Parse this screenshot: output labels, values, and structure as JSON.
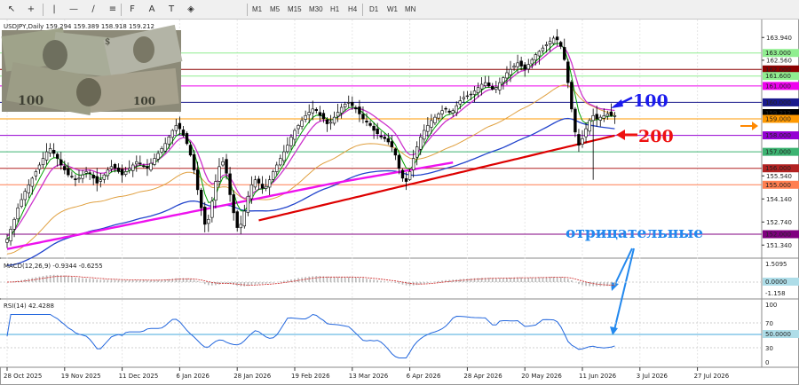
{
  "toolbar": {
    "tools": [
      {
        "name": "cursor-icon",
        "glyph": "↖"
      },
      {
        "name": "crosshair-icon",
        "glyph": "+"
      },
      {
        "name": "vertical-line-icon",
        "glyph": "|"
      },
      {
        "name": "horizontal-line-icon",
        "glyph": "—"
      },
      {
        "name": "trendline-icon",
        "glyph": "∕"
      },
      {
        "name": "channel-icon",
        "glyph": "≡"
      },
      {
        "name": "fibonacci-icon",
        "glyph": "F"
      },
      {
        "name": "text-icon",
        "glyph": "A"
      },
      {
        "name": "label-icon",
        "glyph": "T"
      },
      {
        "name": "shapes-icon",
        "glyph": "◈"
      }
    ],
    "timeframes": [
      "M1",
      "M5",
      "M15",
      "M30",
      "H1",
      "H4",
      "D1",
      "W1",
      "MN"
    ]
  },
  "chart": {
    "header": "USDJPY,Daily 159.294 159.389 158.918 159.212",
    "price_scale": {
      "labels": [
        {
          "text": "163.940",
          "v": 163.94
        },
        {
          "text": "162.560",
          "v": 162.56
        },
        {
          "text": "155.540",
          "v": 155.54
        },
        {
          "text": "154.140",
          "v": 154.14
        },
        {
          "text": "152.740",
          "v": 152.74
        },
        {
          "text": "151.340",
          "v": 151.34
        }
      ],
      "level_labels": [
        {
          "text": "163.000",
          "v": 163.0,
          "bg": "#90ee90",
          "fg": "#ffffff"
        },
        {
          "text": "162.000",
          "v": 162.0,
          "bg": "#8b0000",
          "fg": "#ffffff"
        },
        {
          "text": "161.600",
          "v": 161.6,
          "bg": "#90ee90",
          "fg": "#ffffff"
        },
        {
          "text": "161.000",
          "v": 161.0,
          "bg": "#ee00ee",
          "fg": "#ffffff"
        },
        {
          "text": "160.000",
          "v": 160.0,
          "bg": "#1a1a8c",
          "fg": "#ffffff"
        },
        {
          "text": "159.212",
          "v": 159.35,
          "bg": "#000000",
          "fg": "#ffffff"
        },
        {
          "text": "159.000",
          "v": 159.0,
          "bg": "#ff9900",
          "fg": "#ffffff"
        },
        {
          "text": "158.000",
          "v": 158.0,
          "bg": "#9400d3",
          "fg": "#ffffff"
        },
        {
          "text": "157.000",
          "v": 157.0,
          "bg": "#3cb371",
          "fg": "#ffffff"
        },
        {
          "text": "156.000",
          "v": 156.0,
          "bg": "#b22222",
          "fg": "#ffffff"
        },
        {
          "text": "155.000",
          "v": 155.0,
          "bg": "#ff7f50",
          "fg": "#ffffff"
        },
        {
          "text": "152.000",
          "v": 152.0,
          "bg": "#800080",
          "fg": "#ffffff"
        }
      ]
    },
    "annotations": {
      "ma100": "100",
      "ma200": "200",
      "negative": "отрицательные"
    },
    "macd": {
      "label": "MACD(12,26,9) -0.9344 -0.6255",
      "scale": [
        "1.5095",
        "0.0000",
        "-1.158"
      ]
    },
    "rsi": {
      "label": "RSI(14) 42.4288",
      "scale": [
        "100",
        "70",
        "50.0000",
        "30",
        "0"
      ]
    },
    "dates": [
      {
        "text": "28 Oct 2025",
        "i": 0
      },
      {
        "text": "19 Nov 2025",
        "i": 16
      },
      {
        "text": "11 Dec 2025",
        "i": 32
      },
      {
        "text": "6 Jan 2026",
        "i": 48
      },
      {
        "text": "28 Jan 2026",
        "i": 64
      },
      {
        "text": "19 Feb 2026",
        "i": 80
      },
      {
        "text": "13 Mar 2026",
        "i": 96
      },
      {
        "text": "6 Apr 2026",
        "i": 112
      },
      {
        "text": "28 Apr 2026",
        "i": 128
      },
      {
        "text": "20 May 2026",
        "i": 144
      },
      {
        "text": "11 Jun 2026",
        "i": 160
      },
      {
        "text": "3 Jul 2026",
        "i": 176
      },
      {
        "text": "27 Jul 2026",
        "i": 192
      }
    ],
    "closes": [
      151.7,
      152.3,
      152.9,
      153.6,
      154.1,
      154.6,
      155.0,
      155.4,
      155.8,
      156.2,
      156.6,
      157.0,
      157.2,
      156.9,
      156.6,
      156.2,
      155.9,
      155.6,
      155.5,
      155.3,
      155.4,
      155.6,
      155.8,
      155.7,
      155.4,
      155.1,
      155.3,
      155.6,
      155.9,
      156.1,
      156.0,
      155.8,
      155.6,
      155.8,
      156.0,
      156.2,
      156.4,
      156.3,
      156.1,
      156.0,
      156.3,
      156.6,
      156.9,
      157.2,
      157.5,
      157.9,
      158.3,
      158.6,
      158.4,
      158.0,
      157.5,
      156.8,
      155.9,
      154.7,
      153.6,
      152.6,
      152.9,
      154.0,
      155.2,
      156.1,
      156.4,
      155.7,
      154.4,
      153.3,
      152.4,
      152.6,
      153.4,
      154.3,
      155.0,
      155.3,
      155.1,
      154.8,
      154.9,
      155.3,
      155.8,
      156.2,
      156.6,
      157.0,
      157.4,
      157.9,
      158.3,
      158.6,
      158.9,
      159.2,
      159.4,
      159.6,
      159.5,
      159.2,
      159.0,
      158.7,
      158.8,
      159.1,
      159.4,
      159.7,
      159.9,
      160.0,
      159.8,
      159.6,
      159.3,
      159.0,
      158.8,
      158.6,
      158.3,
      158.1,
      157.9,
      157.8,
      157.6,
      157.3,
      156.8,
      156.0,
      155.4,
      155.2,
      155.8,
      156.6,
      157.3,
      157.9,
      158.3,
      158.6,
      158.9,
      159.1,
      159.3,
      159.5,
      159.6,
      159.4,
      159.5,
      159.8,
      160.1,
      160.3,
      160.4,
      160.5,
      160.7,
      160.9,
      161.1,
      161.2,
      161.0,
      160.8,
      160.9,
      161.2,
      161.5,
      161.8,
      162.0,
      162.2,
      162.4,
      162.2,
      162.0,
      162.3,
      162.6,
      162.9,
      163.1,
      163.3,
      163.5,
      163.7,
      163.9,
      163.8,
      163.4,
      162.6,
      161.2,
      159.6,
      158.2,
      157.4,
      157.8,
      158.4,
      158.9,
      159.2,
      159.0,
      159.1,
      159.2,
      159.3,
      159.2,
      159.2
    ]
  },
  "colors": {
    "candle": "#000000",
    "ma_fast": "#00a000",
    "ma_mid": "#cc33cc",
    "ma_orange": "#e0a040",
    "ma100": "#2244cc",
    "ma200_red": "#dd0000",
    "ma200_magenta": "#ee11ee",
    "annotation_blue": "#1a1aee",
    "annotation_red": "#ee1111",
    "arrow_orange": "#ff8800",
    "negative_text": "#2288ee"
  }
}
